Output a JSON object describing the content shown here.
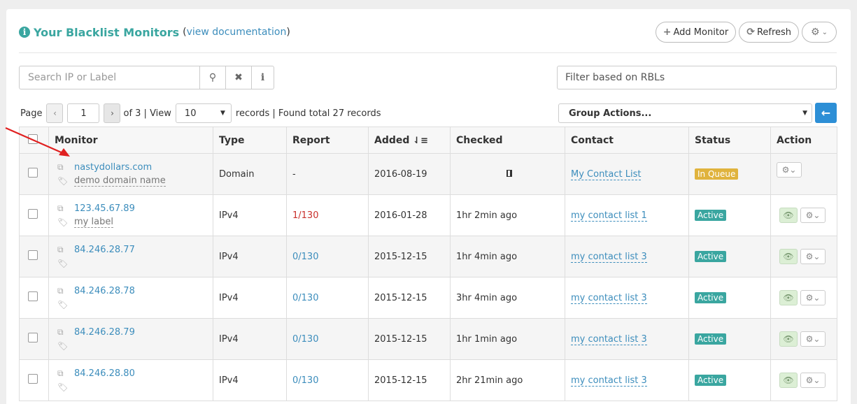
{
  "header": {
    "title": "Your Blacklist Monitors",
    "paren_open": "(",
    "doc_link": "view documentation",
    "paren_close": ")",
    "add_label": "Add Monitor",
    "refresh_label": "Refresh"
  },
  "search": {
    "placeholder": "Search IP or Label",
    "rbl_placeholder": "Filter based on RBLs"
  },
  "pager": {
    "page_label": "Page",
    "current": "1",
    "of_text": "of 3 | View",
    "view_value": "10",
    "found_text": "records | Found total 27 records"
  },
  "group_actions": "Group Actions...",
  "columns": [
    "Monitor",
    "Type",
    "Report",
    "Added",
    "Checked",
    "Contact",
    "Status",
    "Action"
  ],
  "rows": [
    {
      "monitor": "nastydollars.com",
      "label": "demo domain name",
      "type": "Domain",
      "report": "-",
      "added": "2016-08-19",
      "checked": "",
      "contact": "My Contact List",
      "status": "In Queue"
    },
    {
      "monitor": "123.45.67.89",
      "label": "my label",
      "type": "IPv4",
      "report": "1/130",
      "added": "2016-01-28",
      "checked": "1hr 2min ago",
      "contact": "my contact list 1",
      "status": "Active"
    },
    {
      "monitor": "84.246.28.77",
      "label": "",
      "type": "IPv4",
      "report": "0/130",
      "added": "2015-12-15",
      "checked": "1hr 4min ago",
      "contact": "my contact list 3",
      "status": "Active"
    },
    {
      "monitor": "84.246.28.78",
      "label": "",
      "type": "IPv4",
      "report": "0/130",
      "added": "2015-12-15",
      "checked": "3hr 4min ago",
      "contact": "my contact list 3",
      "status": "Active"
    },
    {
      "monitor": "84.246.28.79",
      "label": "",
      "type": "IPv4",
      "report": "0/130",
      "added": "2015-12-15",
      "checked": "1hr 1min ago",
      "contact": "my contact list 3",
      "status": "Active"
    },
    {
      "monitor": "84.246.28.80",
      "label": "",
      "type": "IPv4",
      "report": "0/130",
      "added": "2015-12-15",
      "checked": "2hr 21min ago",
      "contact": "my contact list 3",
      "status": "Active"
    }
  ],
  "colors": {
    "accent": "#3aa6a0",
    "link": "#3c8dbc",
    "queue": "#e0b33d",
    "alert": "#c9302c",
    "go": "#2d8fd6"
  }
}
